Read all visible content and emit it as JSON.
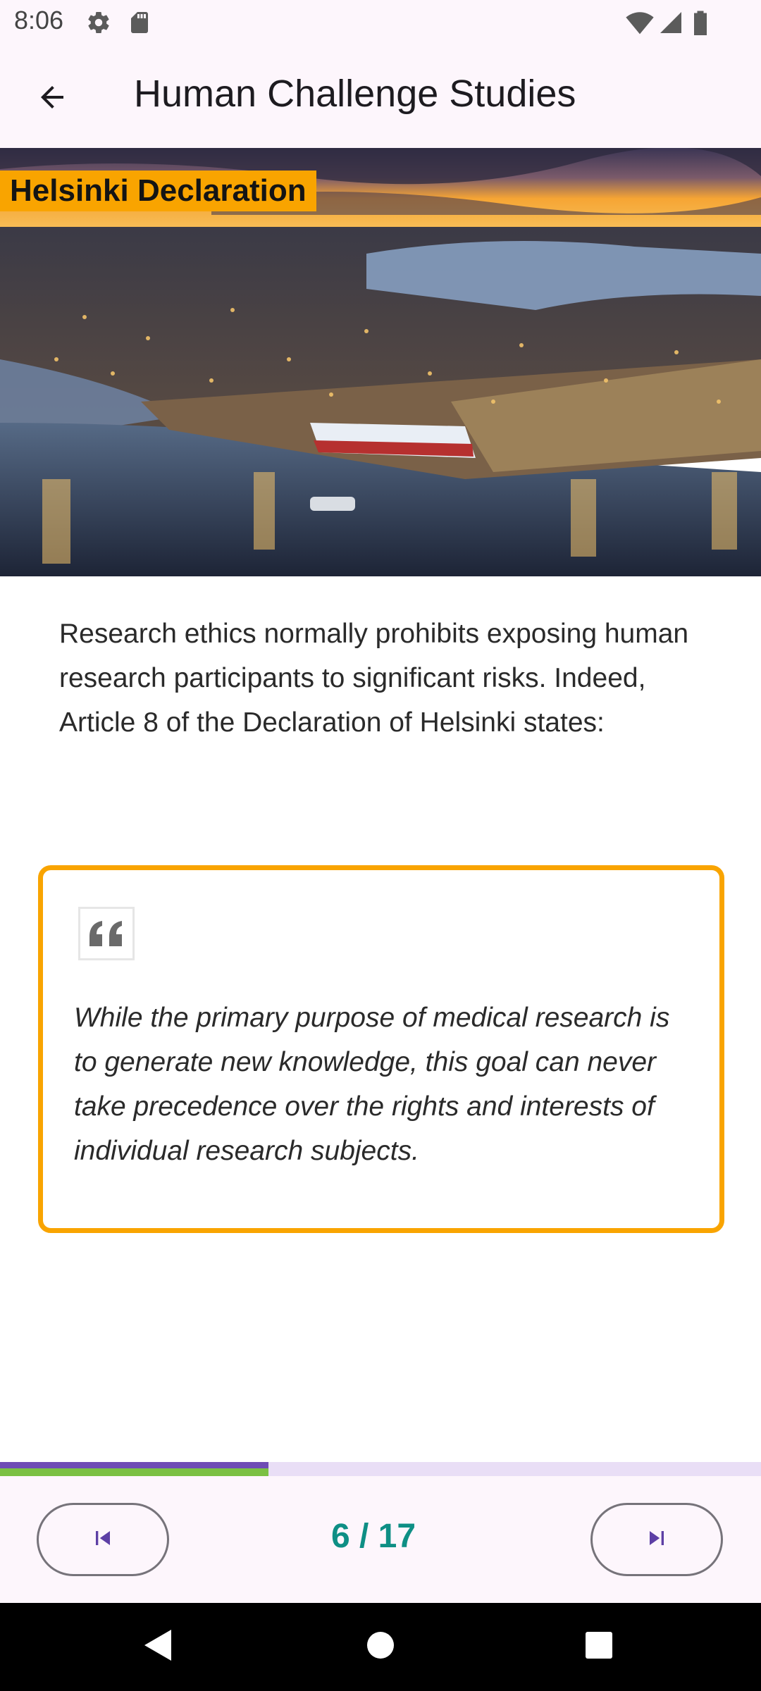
{
  "status_bar": {
    "time": "8:06",
    "icons": [
      "gear-icon",
      "sd-card-icon",
      "wifi-icon",
      "cell-signal-icon",
      "battery-icon"
    ]
  },
  "app_bar": {
    "title": "Human Challenge Studies",
    "back_icon": "arrow-left-icon"
  },
  "hero": {
    "label": "Helsinki Declaration"
  },
  "content": {
    "intro": "Research ethics normally prohibits exposing human research participants to significant risks. Indeed, Article 8 of the Declaration of Helsinki states:",
    "quote": "While the primary purpose of medical research is to generate new knowledge, this goal can never take precedence over the rights and interests of individual research subjects."
  },
  "progress": {
    "current": 6,
    "total": 17,
    "fraction": 0.353
  },
  "pager": {
    "indicator": "6 / 17",
    "prev_icon": "skip-previous-icon",
    "next_icon": "skip-next-icon"
  },
  "colors": {
    "accent_orange": "#f9a400",
    "indicator_teal": "#0e8f85",
    "progress_purple": "#6f4cb5",
    "progress_green": "#7bc043",
    "surface": "#fdf6fc"
  }
}
